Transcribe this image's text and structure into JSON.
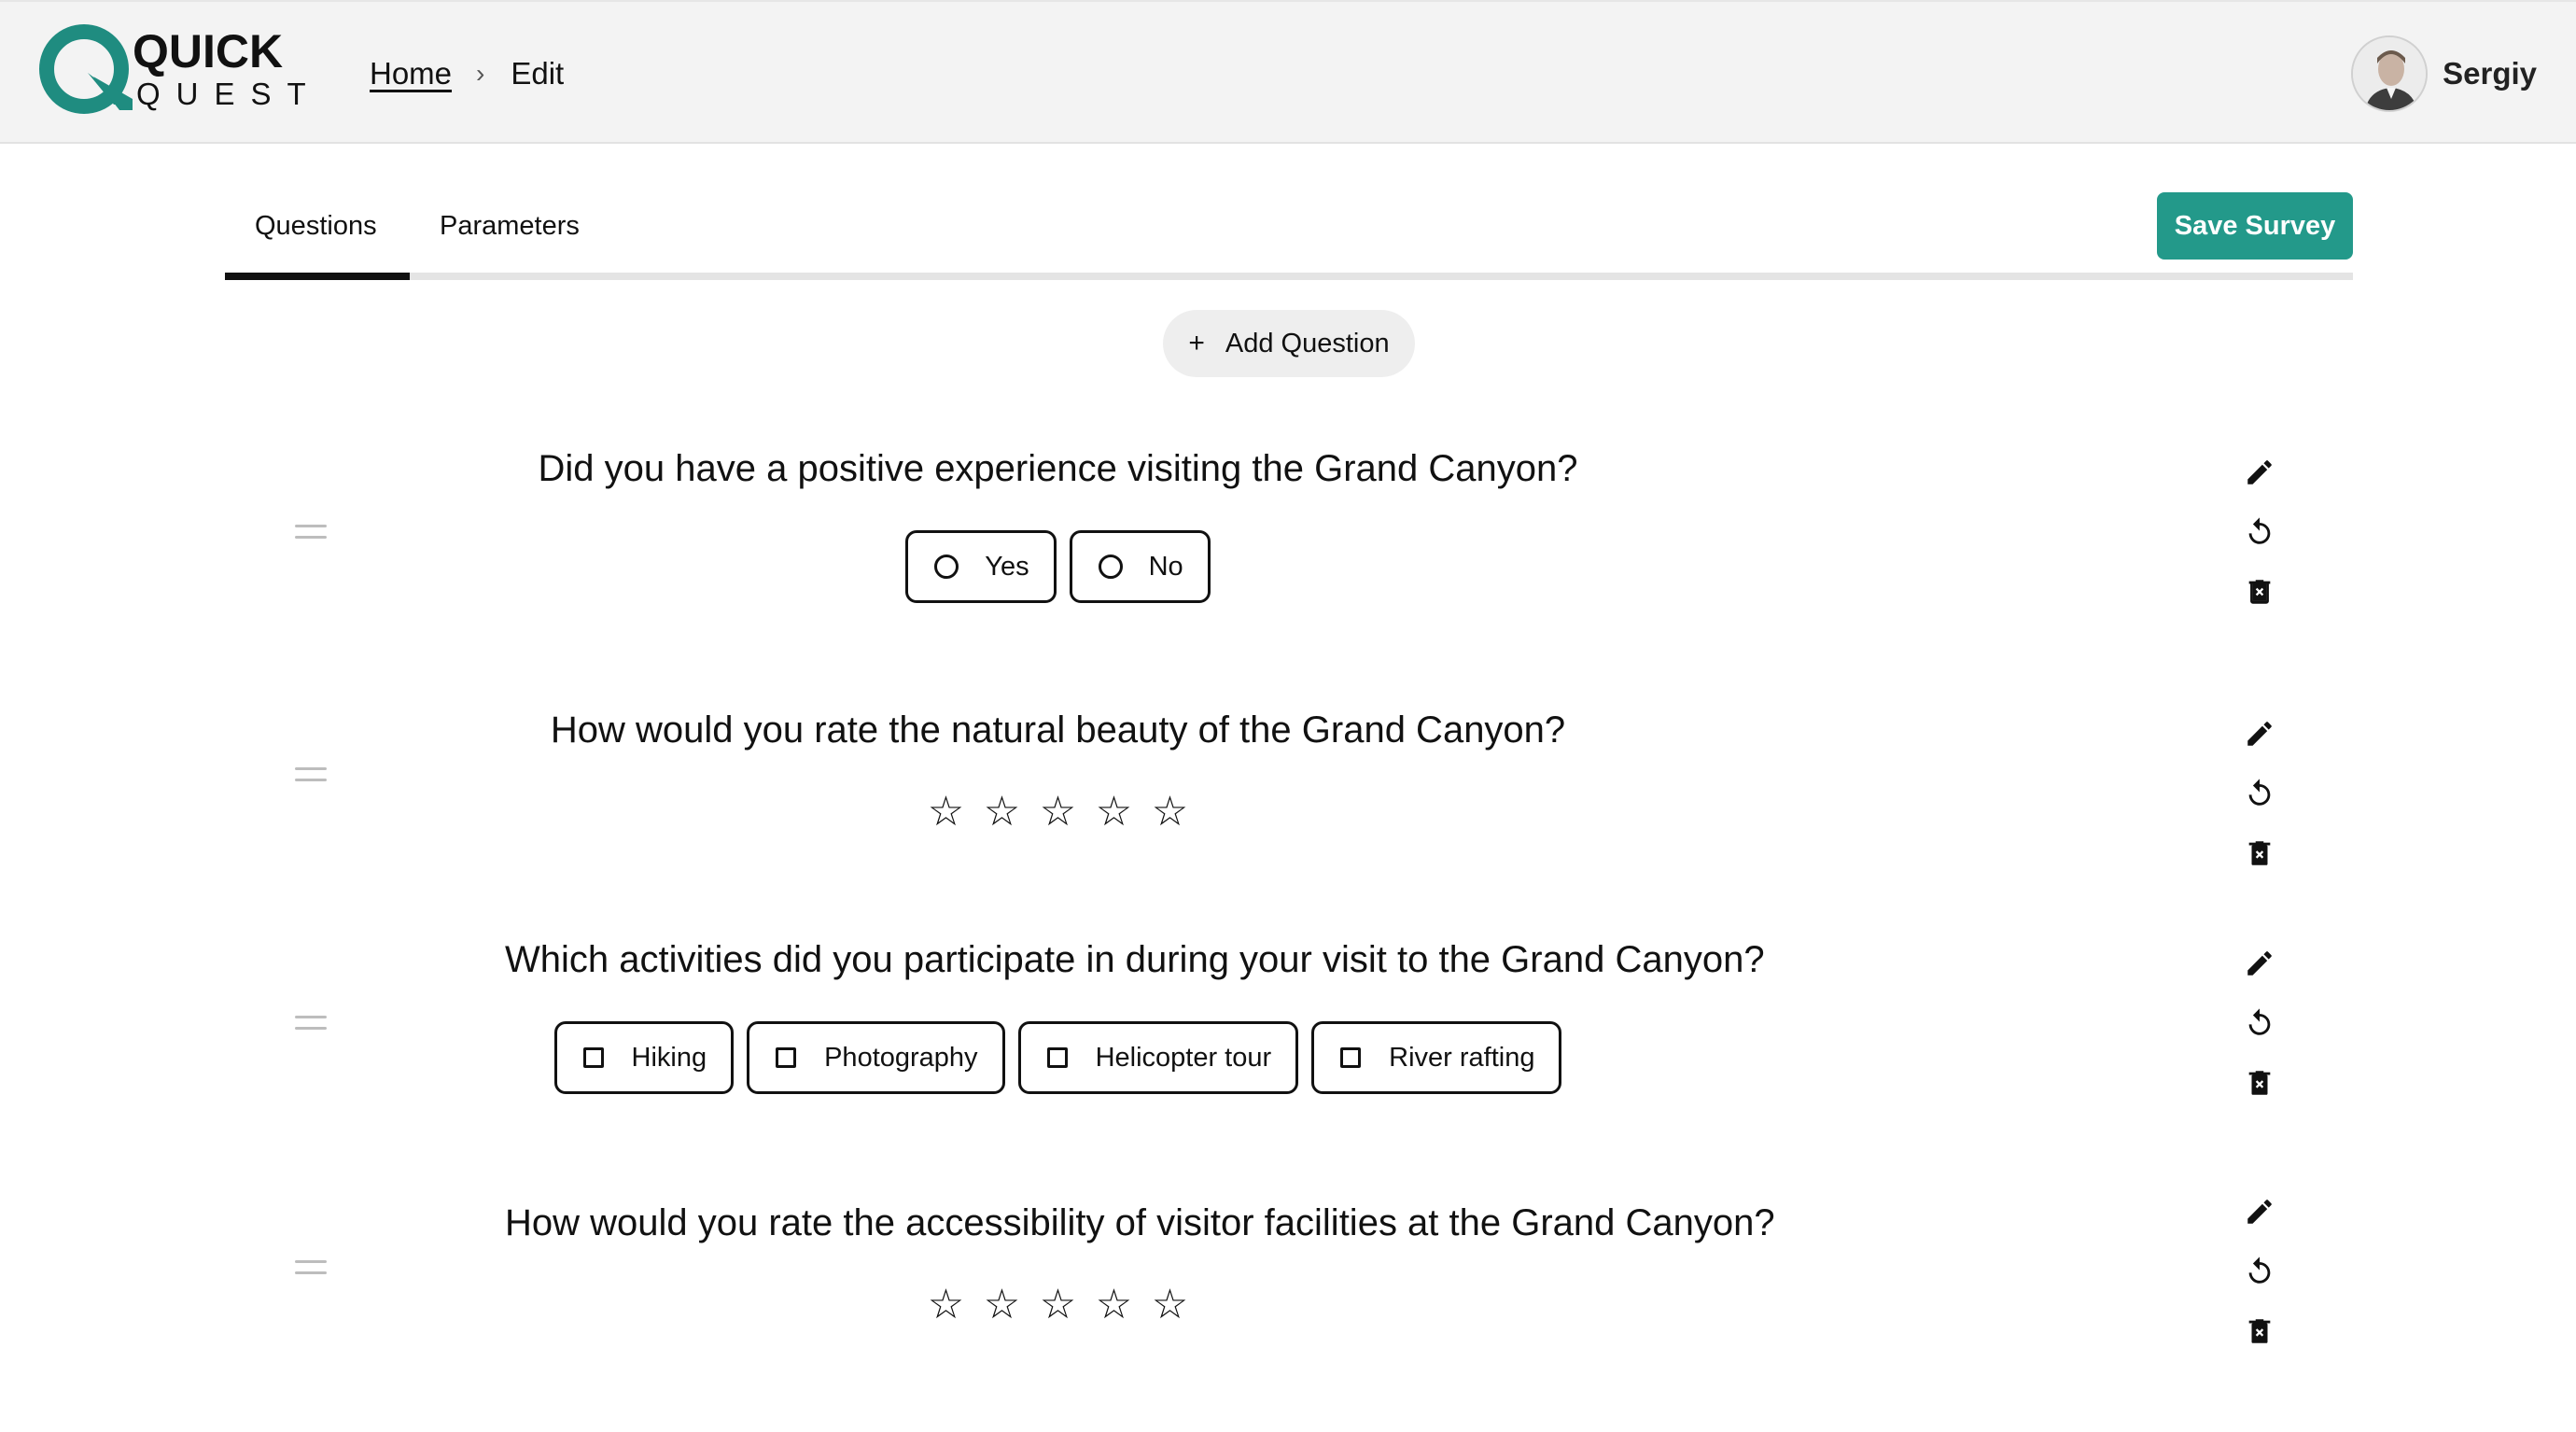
{
  "header": {
    "logo_top": "QUICK",
    "logo_bottom": "QUEST",
    "breadcrumb": {
      "home": "Home",
      "separator": "›",
      "current": "Edit"
    },
    "user_name": "Sergiy"
  },
  "tabs": {
    "items": [
      "Questions",
      "Parameters"
    ],
    "active": "Questions"
  },
  "save_button": "Save Survey",
  "add_question": {
    "icon": "+",
    "label": "Add Question"
  },
  "questions": [
    {
      "type": "radio",
      "title": "Did you have a positive experience visiting the Grand Canyon?",
      "options": [
        "Yes",
        "No"
      ]
    },
    {
      "type": "rating",
      "title": "How would you rate the natural beauty of the Grand Canyon?",
      "stars": 5,
      "rating_value": 0
    },
    {
      "type": "checkbox",
      "title": "Which activities did you participate in during your visit to the Grand Canyon?",
      "options": [
        "Hiking",
        "Photography",
        "Helicopter tour",
        "River rafting"
      ]
    },
    {
      "type": "rating",
      "title": "How would you rate the accessibility of visitor facilities at the Grand Canyon?",
      "stars": 5,
      "rating_value": 0
    }
  ],
  "icons": {
    "drag": "drag-handle-icon",
    "edit": "pencil-icon",
    "reset": "rotate-ccw-icon",
    "delete": "trash-icon",
    "star": "☆"
  },
  "colors": {
    "accent": "#23998a",
    "header_bg": "#f3f3f3"
  }
}
